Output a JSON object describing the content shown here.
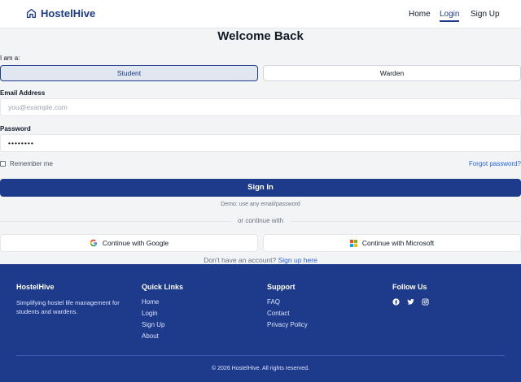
{
  "nav": {
    "brand": "HostelHive",
    "links": [
      "Home",
      "Login",
      "Sign Up"
    ],
    "active": "Login"
  },
  "form": {
    "title": "Welcome Back",
    "role_label": "I am a:",
    "roles": [
      "Student",
      "Warden"
    ],
    "selected_role": "Student",
    "email_label": "Email Address",
    "email_placeholder": "you@example.com",
    "password_label": "Password",
    "password_value": "••••••••",
    "remember_label": "Remember me",
    "remember_checked": false,
    "forgot_label": "Forgot password?",
    "signin_label": "Sign In",
    "demo_note": "Demo: use any email/password",
    "divider_text": "or continue with",
    "google_label": "Continue with Google",
    "microsoft_label": "Continue with Microsoft",
    "account_text": "Don't have an account?",
    "signup_link": "Sign up here"
  },
  "footer": {
    "brand": "HostelHive",
    "tagline": "Simplifying hostel life management for students and wardens.",
    "quick_links_title": "Quick Links",
    "quick_links": [
      "Home",
      "Login",
      "Sign Up",
      "About"
    ],
    "support_title": "Support",
    "support_links": [
      "FAQ",
      "Contact",
      "Privacy Policy"
    ],
    "follow_title": "Follow Us",
    "social_icons": [
      "facebook-icon",
      "twitter-icon",
      "instagram-icon"
    ],
    "copyright": "© 2026 HostelHive. All rights reserved."
  },
  "colors": {
    "primary": "#1e3a8a",
    "link": "#2563eb",
    "background": "#f3f4f6"
  }
}
